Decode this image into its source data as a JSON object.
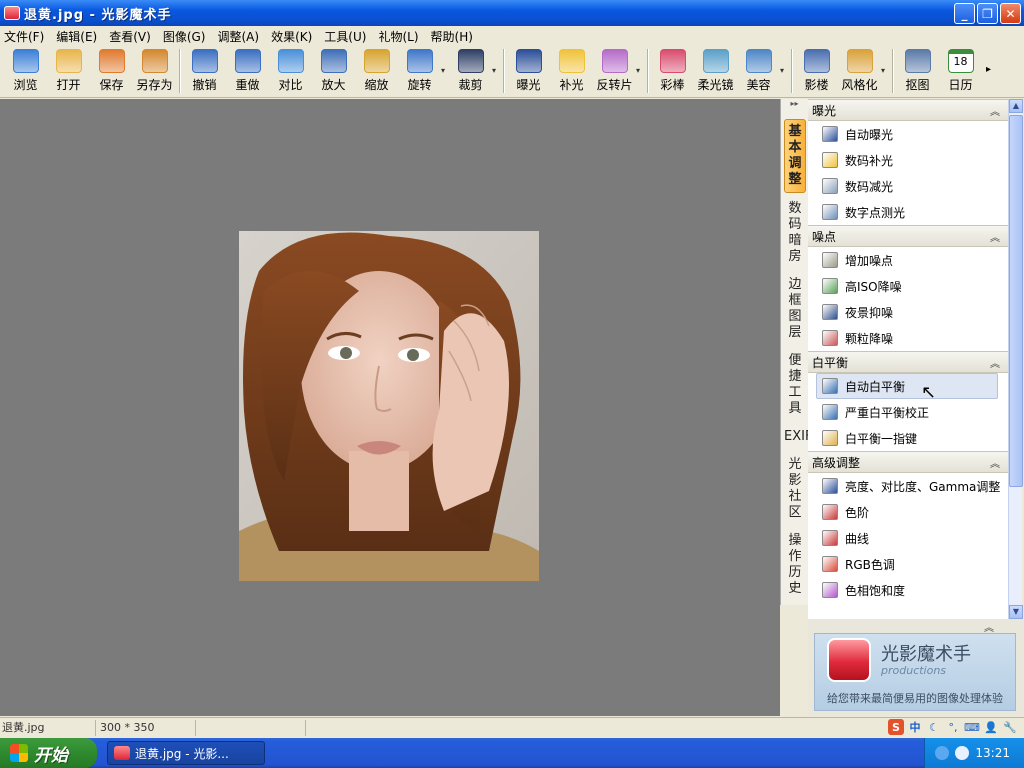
{
  "window": {
    "title": "退黄.jpg - 光影魔术手",
    "buttons": {
      "minimize": "_",
      "restore": "❐",
      "close": "✕"
    }
  },
  "menu": [
    "文件(F)",
    "编辑(E)",
    "查看(V)",
    "图像(G)",
    "调整(A)",
    "效果(K)",
    "工具(U)",
    "礼物(L)",
    "帮助(H)"
  ],
  "toolbar": {
    "groups": [
      [
        {
          "label": "浏览",
          "icon": "browse-icon",
          "color": "#3b7fd6"
        },
        {
          "label": "打开",
          "icon": "open-folder-icon",
          "color": "#e8b54a"
        },
        {
          "label": "保存",
          "icon": "save-icon",
          "color": "#e07a2e"
        },
        {
          "label": "另存为",
          "icon": "save-as-icon",
          "color": "#d4882f"
        }
      ],
      [
        {
          "label": "撤销",
          "icon": "undo-icon",
          "color": "#3a6fc2"
        },
        {
          "label": "重做",
          "icon": "redo-icon",
          "color": "#3a6fc2"
        },
        {
          "label": "对比",
          "icon": "compare-icon",
          "color": "#4a90d9"
        },
        {
          "label": "放大",
          "icon": "zoom-in-icon",
          "color": "#3f6fb8"
        },
        {
          "label": "缩放",
          "icon": "resize-icon",
          "color": "#d7a42f"
        },
        {
          "label": "旋转",
          "icon": "rotate-icon",
          "color": "#3f77c9"
        },
        {
          "label": "裁剪",
          "icon": "crop-icon",
          "color": "#2f3f66"
        }
      ],
      [
        {
          "label": "曝光",
          "icon": "exposure-icon",
          "color": "#2c4f99"
        },
        {
          "label": "补光",
          "icon": "fill-light-icon",
          "color": "#f0c23a"
        },
        {
          "label": "反转片",
          "icon": "reverse-film-icon",
          "color": "#b56bc9"
        }
      ],
      [
        {
          "label": "彩棒",
          "icon": "color-wand-icon",
          "color": "#d94c6f"
        },
        {
          "label": "柔光镜",
          "icon": "soft-light-icon",
          "color": "#5aa0c8"
        },
        {
          "label": "美容",
          "icon": "beauty-icon",
          "color": "#4d87c7"
        }
      ],
      [
        {
          "label": "影楼",
          "icon": "studio-icon",
          "color": "#4a6fb0"
        },
        {
          "label": "风格化",
          "icon": "stylize-icon",
          "color": "#d9a23a"
        }
      ],
      [
        {
          "label": "抠图",
          "icon": "cutout-icon",
          "color": "#5a7aa8"
        },
        {
          "label": "日历",
          "icon": "calendar-icon",
          "color": "#3a8d3a"
        }
      ]
    ],
    "calendar_day": "18"
  },
  "side_tabs": [
    "基本调整",
    "数码暗房",
    "边框图层",
    "便捷工具",
    "EXIF",
    "光影社区",
    "操作历史"
  ],
  "panel": {
    "sections": [
      {
        "title": "曝光",
        "items": [
          {
            "label": "自动曝光",
            "icon": "auto-exposure-icon",
            "color": "#2c4f99"
          },
          {
            "label": "数码补光",
            "icon": "digital-fill-light-icon",
            "color": "#f0c23a"
          },
          {
            "label": "数码减光",
            "icon": "digital-reduce-light-icon",
            "color": "#8aa0b8"
          },
          {
            "label": "数字点测光",
            "icon": "spot-metering-icon",
            "color": "#6f8fb8"
          }
        ]
      },
      {
        "title": "噪点",
        "items": [
          {
            "label": "增加噪点",
            "icon": "add-noise-icon",
            "color": "#9a9a8a"
          },
          {
            "label": "高ISO降噪",
            "icon": "iso-denoise-icon",
            "color": "#5aa05a"
          },
          {
            "label": "夜景抑噪",
            "icon": "night-denoise-icon",
            "color": "#2f4f8a"
          },
          {
            "label": "颗粒降噪",
            "icon": "grain-denoise-icon",
            "color": "#c75a5a"
          }
        ]
      },
      {
        "title": "白平衡",
        "items": [
          {
            "label": "自动白平衡",
            "icon": "auto-white-balance-icon",
            "color": "#3a6fb0"
          },
          {
            "label": "严重白平衡校正",
            "icon": "severe-wb-correct-icon",
            "color": "#3a6fb0"
          },
          {
            "label": "白平衡一指键",
            "icon": "wb-one-touch-icon",
            "color": "#e0b050"
          }
        ]
      },
      {
        "title": "高级调整",
        "items": [
          {
            "label": "亮度、对比度、Gamma调整",
            "icon": "brightness-contrast-icon",
            "color": "#2c4f99"
          },
          {
            "label": "色阶",
            "icon": "levels-icon",
            "color": "#c93a3a"
          },
          {
            "label": "曲线",
            "icon": "curves-icon",
            "color": "#c93a3a"
          },
          {
            "label": "RGB色调",
            "icon": "rgb-tone-icon",
            "color": "#d94c3a"
          },
          {
            "label": "色相饱和度",
            "icon": "hue-saturation-icon",
            "color": "#b05ac9"
          }
        ]
      }
    ],
    "hovered_item": "自动白平衡"
  },
  "banner": {
    "title": "光影魔术手",
    "subtitle": "productions",
    "slogan": "给您带来最简便易用的图像处理体验"
  },
  "status": {
    "filename": "退黄.jpg",
    "dimensions": "300 * 350"
  },
  "ime": [
    "S",
    "中",
    "☾",
    "°,",
    "⌨",
    "👤",
    "🔧"
  ],
  "taskbar": {
    "start": "开始",
    "task": "退黄.jpg - 光影...",
    "clock": "13:21"
  }
}
